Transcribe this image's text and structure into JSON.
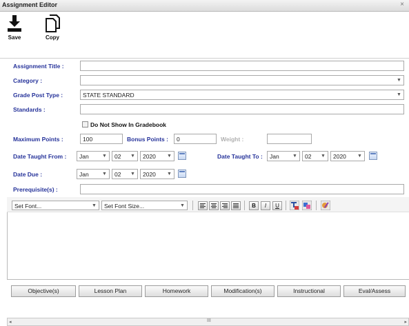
{
  "window": {
    "title": "Assignment Editor",
    "close_glyph": "×"
  },
  "toolbar": {
    "save_label": "Save",
    "copy_label": "Copy"
  },
  "form": {
    "title_label": "Assignment Title :",
    "title_value": "",
    "category_label": "Category :",
    "category_value": "",
    "grade_post_label": "Grade Post Type :",
    "grade_post_value": "STATE STANDARD",
    "standards_label": "Standards :",
    "standards_value": "",
    "hide_checkbox_label": "Do Not Show In Gradebook",
    "max_points_label": "Maximum Points :",
    "max_points_value": "100",
    "bonus_points_label": "Bonus Points :",
    "bonus_points_value": "0",
    "weight_label": "Weight :",
    "weight_value": "",
    "date_taught_from_label": "Date Taught From :",
    "date_taught_from": {
      "month": "Jan",
      "day": "02",
      "year": "2020"
    },
    "date_taught_to_label": "Date Taught To :",
    "date_taught_to": {
      "month": "Jan",
      "day": "02",
      "year": "2020"
    },
    "date_due_label": "Date Due :",
    "date_due": {
      "month": "Jan",
      "day": "02",
      "year": "2020"
    },
    "prerequisites_label": "Prerequisite(s) :",
    "prerequisites_value": ""
  },
  "editor": {
    "font_select": "Set Font...",
    "size_select": "Set Font Size...",
    "bold": "B",
    "italic": "I",
    "underline": "U"
  },
  "tabs": [
    {
      "label": "Objective(s)"
    },
    {
      "label": "Lesson Plan"
    },
    {
      "label": "Homework"
    },
    {
      "label": "Modification(s)"
    },
    {
      "label": "Instructional"
    },
    {
      "label": "Eval/Assess"
    }
  ],
  "scrollbar": {
    "thumb_glyph": "III"
  },
  "icons": [
    "save-icon",
    "copy-icon",
    "calendar-icon",
    "dropdown-arrow-icon",
    "align-left-icon",
    "align-center-icon",
    "align-right-icon",
    "align-justify-icon",
    "text-color-icon",
    "background-color-icon",
    "clear-format-icon"
  ]
}
